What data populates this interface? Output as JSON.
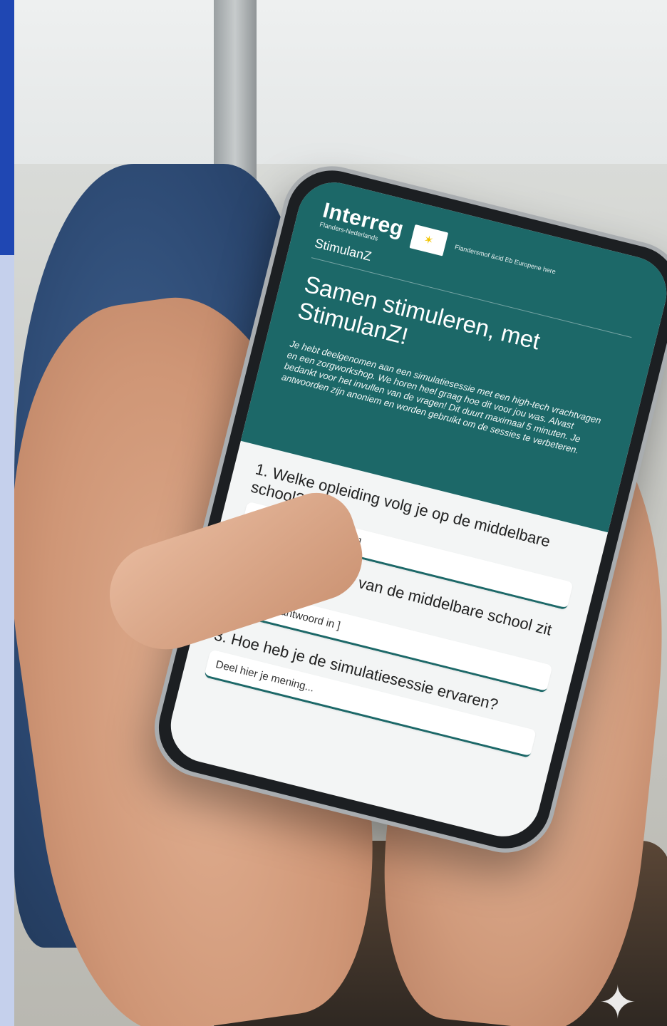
{
  "phone_screen": {
    "brand": "Interreg",
    "brand_sub": "Flanders-Nederlands",
    "eu_text": "Flandersmof &cid Eb Europene here",
    "project": "StimulanZ",
    "title": "Samen stimuleren, met StimulanZ!",
    "intro": "Je hebt deelgenomen aan een simulatiesessie met een high-tech vrachtvagen en een zorgworkshop. We horen heel graag hoe dit voor jou was. Alvast bedankt voor het invullen van de vragen! Dit duurt maximaal 5 minuten. Je antwoorden zijn anoniem en worden gebruikt om de sessies te verbeteren.",
    "questions": [
      {
        "label": "1. Welke opleiding volg je op de middelbare school?",
        "placeholder": "Vul hier je antwoord in ]"
      },
      {
        "label": "2. In welk leerjaar van de middelbare school zit je?",
        "placeholder": "Vul hier je antwoord in ]"
      },
      {
        "label": "3. Hoe heb je de simulatiesessie ervaren?",
        "placeholder": "Deel hier je mening..."
      }
    ]
  },
  "colors": {
    "header_teal": "#1c6868",
    "accent_blue": "#1f47b3",
    "side_stripe": "#c5d0ec"
  },
  "icons": [
    "eu-flag-icon",
    "sparkle-icon"
  ]
}
